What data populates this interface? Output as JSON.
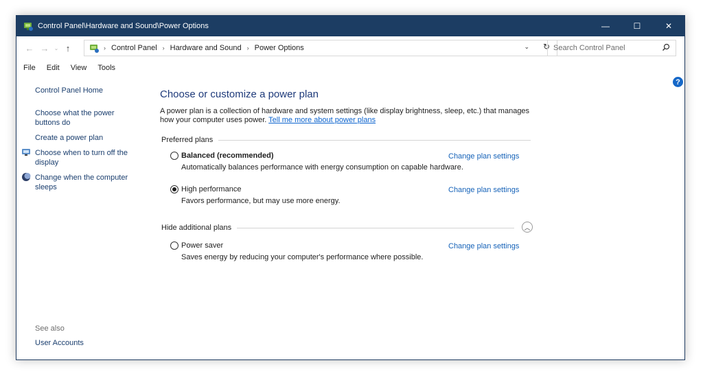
{
  "window": {
    "title": "Control Panel\\Hardware and Sound\\Power Options",
    "buttons": {
      "minimize": "—",
      "maximize": "☐",
      "close": "✕"
    }
  },
  "nav": {
    "back": "←",
    "forward": "→",
    "recent": "⌄",
    "up": "↑",
    "breadcrumbs": [
      "Control Panel",
      "Hardware and Sound",
      "Power Options"
    ],
    "separator": "›",
    "dropdown": "⌄",
    "refresh": "↻"
  },
  "search": {
    "placeholder": "Search Control Panel"
  },
  "menu": [
    "File",
    "Edit",
    "View",
    "Tools"
  ],
  "sidebar": {
    "home": "Control Panel Home",
    "links": [
      "Choose what the power buttons do",
      "Create a power plan",
      "Choose when to turn off the display",
      "Change when the computer sleeps"
    ],
    "see_also_label": "See also",
    "user_accounts": "User Accounts"
  },
  "help": "?",
  "main": {
    "title": "Choose or customize a power plan",
    "description": "A power plan is a collection of hardware and system settings (like display brightness, sleep, etc.) that manages how your computer uses power.",
    "learn_more": "Tell me more about power plans",
    "preferred_label": "Preferred plans",
    "hidden_label": "Hide additional plans",
    "change_label": "Change plan settings",
    "plans": [
      {
        "name": "Balanced (recommended)",
        "description": "Automatically balances performance with energy consumption on capable hardware.",
        "selected": false
      },
      {
        "name": "High performance",
        "description": "Favors performance, but may use more energy.",
        "selected": true
      },
      {
        "name": "Power saver",
        "description": "Saves energy by reducing your computer's performance where possible.",
        "selected": false
      }
    ]
  },
  "colors": {
    "titlebar": "#1c3d63",
    "link": "#1562b8",
    "heading": "#1e3a7a"
  }
}
